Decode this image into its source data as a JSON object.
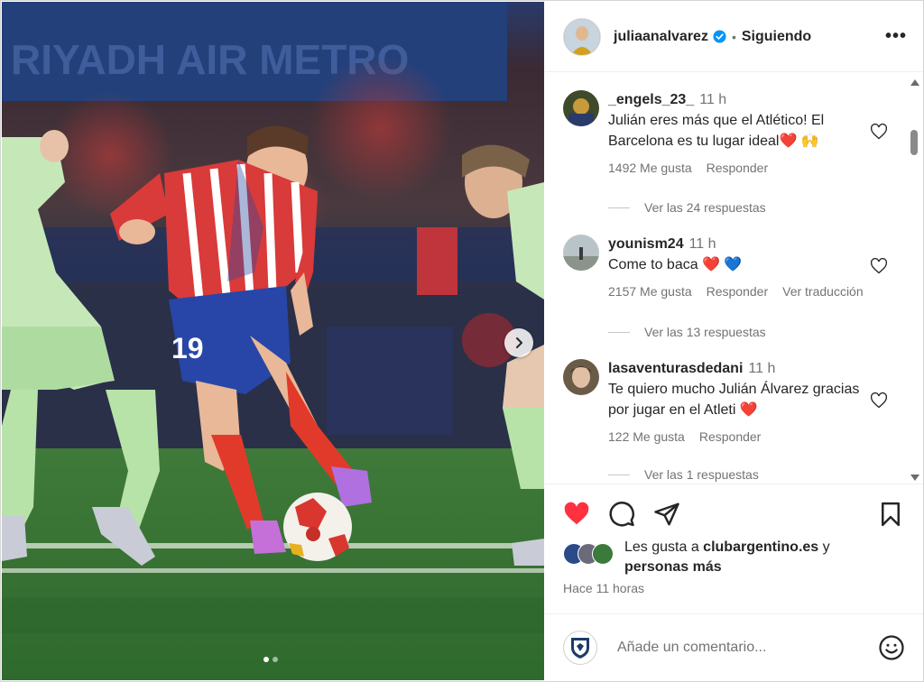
{
  "post": {
    "username": "juliaanalvarez",
    "separator": "•",
    "follow_status": "Siguiendo",
    "more_label": "•••"
  },
  "comments": [
    {
      "username": "_engels_23_",
      "time": "11 h",
      "text": "Julián eres más que el Atlético! El Barcelona es tu lugar ideal❤️ 🙌",
      "likes": "1492 Me gusta",
      "reply": "Responder",
      "translate": "",
      "view_replies": "Ver las 24 respuestas"
    },
    {
      "username": "younism24",
      "time": "11 h",
      "text": "Come to baca ❤️ 💙",
      "likes": "2157 Me gusta",
      "reply": "Responder",
      "translate": "Ver traducción",
      "view_replies": "Ver las 13 respuestas"
    },
    {
      "username": "lasaventurasdedani",
      "time": "11 h",
      "text": "Te quiero mucho Julián Álvarez gracias por jugar en el Atleti ❤️",
      "likes": "122 Me gusta",
      "reply": "Responder",
      "translate": "",
      "view_replies": "Ver las 1 respuestas"
    }
  ],
  "likes": {
    "prefix": "Les gusta a ",
    "user": "clubargentino.es",
    "connector": " y",
    "rest": "personas más"
  },
  "time_ago": "Hace 11 horas",
  "add_comment": {
    "placeholder": "Añade un comentario..."
  },
  "colors": {
    "heart_active": "#ff3040",
    "verified": "#0095f6",
    "muted": "#737373"
  },
  "icons": {
    "like": "heart-icon",
    "comment": "comment-icon",
    "share": "paper-plane-icon",
    "save": "bookmark-icon",
    "emoji": "smiley-icon",
    "more": "more-dots-icon",
    "next": "chevron-right-icon"
  },
  "carousel": {
    "slide_count": 2,
    "active_index": 1
  }
}
